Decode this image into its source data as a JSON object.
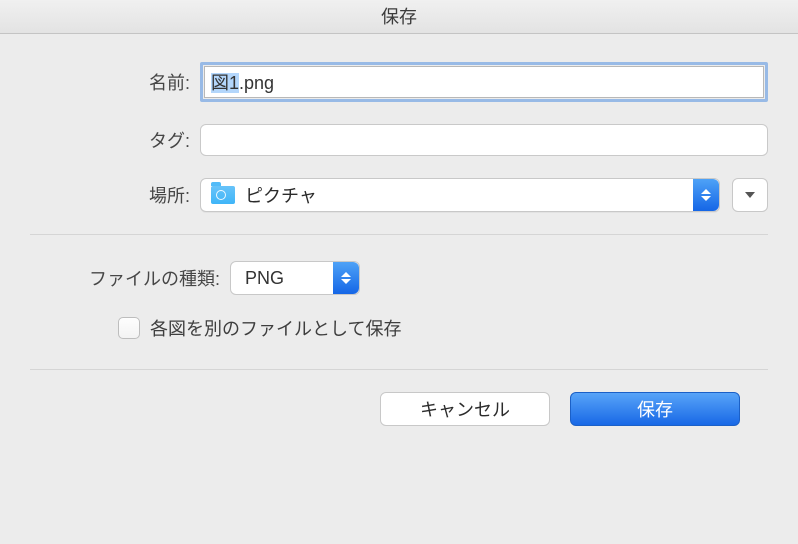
{
  "window": {
    "title": "保存"
  },
  "form": {
    "name_label": "名前:",
    "filename_selected": "図1",
    "filename_rest": ".png",
    "tags_label": "タグ:",
    "tags_value": "",
    "location_label": "場所:",
    "location_value": "ピクチャ",
    "filetype_label": "ファイルの種類:",
    "filetype_value": "PNG",
    "checkbox_label": "各図を別のファイルとして保存",
    "checkbox_checked": false
  },
  "buttons": {
    "cancel": "キャンセル",
    "save": "保存"
  }
}
